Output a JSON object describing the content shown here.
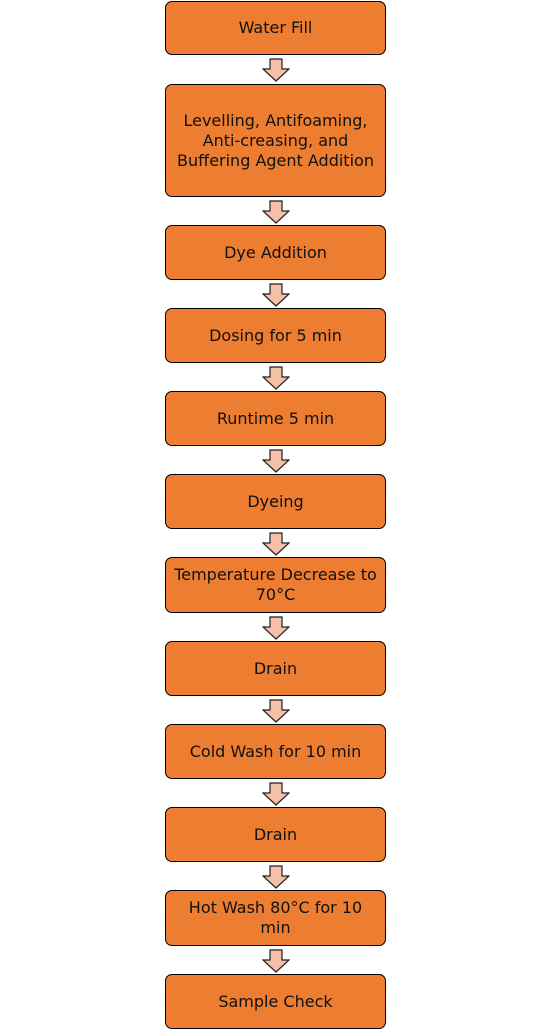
{
  "colors": {
    "box": "#ED7D31",
    "arrow": "#F4C0A8",
    "border": "#000000"
  },
  "steps": [
    "Water Fill",
    "Levelling, Antifoaming, Anti-creasing, and Buffering Agent Addition",
    "Dye Addition",
    "Dosing for 5 min",
    "Runtime 5 min",
    "Dyeing",
    "Temperature Decrease to 70°C",
    "Drain",
    "Cold Wash for 10 min",
    "Drain",
    "Hot Wash 80°C for 10 min",
    "Sample Check"
  ]
}
